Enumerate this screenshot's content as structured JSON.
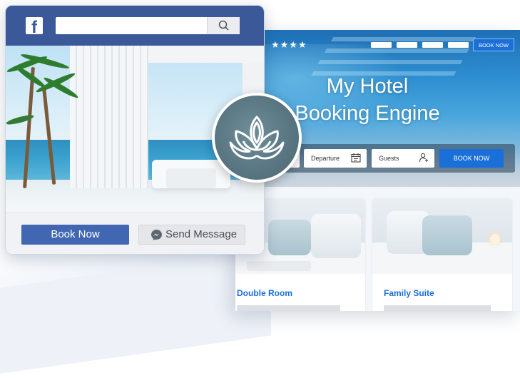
{
  "facebook": {
    "logo_letter": "f",
    "book_now_label": "Book Now",
    "send_message_label": "Send Message",
    "brand_color": "#3b5998"
  },
  "hotel_site": {
    "stars": "★★★★",
    "top_book_label": "BOOK NOW",
    "hero_title_line1": "My Hotel",
    "hero_title_line2": "Booking Engine",
    "search": {
      "departure_label": "Departure",
      "guests_label": "Guests",
      "book_label": "BOOK NOW"
    },
    "rooms": [
      {
        "name": "Double Room"
      },
      {
        "name": "Family Suite"
      }
    ],
    "accent_color": "#1a6fd8"
  },
  "badge": {
    "icon": "lotus-icon"
  }
}
